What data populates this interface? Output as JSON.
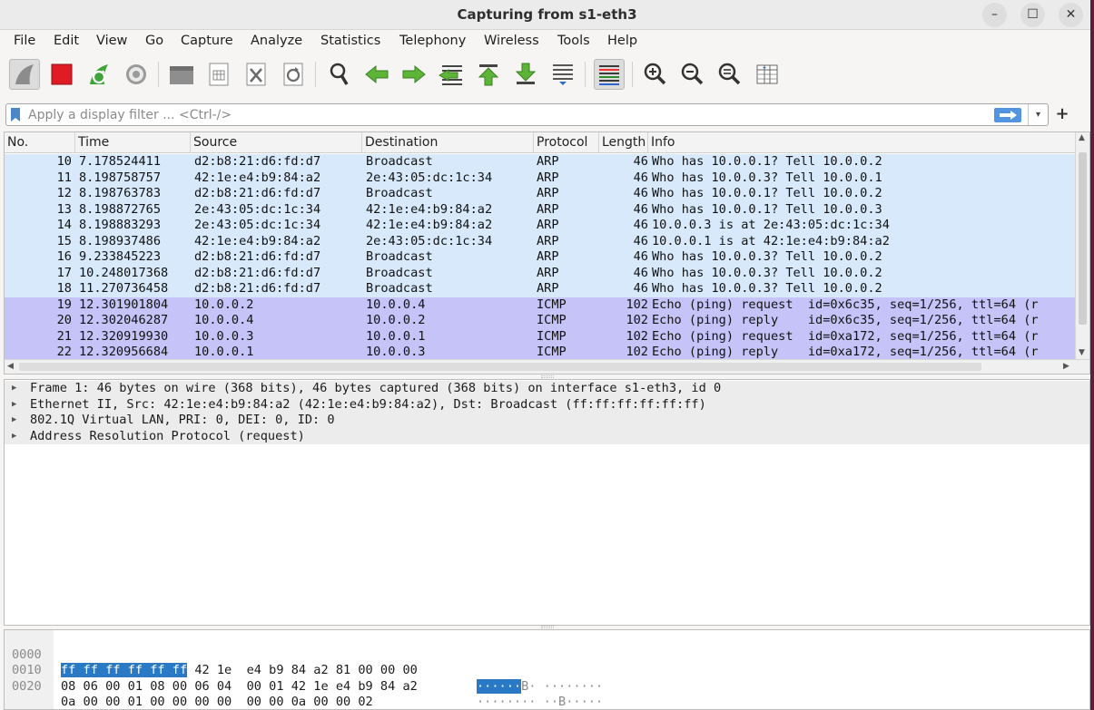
{
  "window": {
    "title": "Capturing from s1-eth3",
    "minimize": "–",
    "maximize": "☐",
    "close": "✕"
  },
  "menu": [
    "File",
    "Edit",
    "View",
    "Go",
    "Capture",
    "Analyze",
    "Statistics",
    "Telephony",
    "Wireless",
    "Tools",
    "Help"
  ],
  "toolbar": {
    "icons": [
      "shark-fin-start-icon",
      "stop-capture-icon",
      "restart-capture-icon",
      "capture-options-gear-icon",
      "open-file-icon",
      "save-file-icon",
      "close-file-icon",
      "reload-file-icon",
      "find-packet-icon",
      "go-back-icon",
      "go-forward-icon",
      "go-to-packet-icon",
      "go-first-icon",
      "go-last-icon",
      "auto-scroll-icon",
      "colorize-icon",
      "zoom-in-icon",
      "zoom-out-icon",
      "zoom-normal-icon",
      "resize-columns-icon"
    ]
  },
  "filter": {
    "placeholder": "Apply a display filter ... <Ctrl-/>",
    "value": "",
    "add_button": "+"
  },
  "packet_list": {
    "columns": [
      "No.",
      "Time",
      "Source",
      "Destination",
      "Protocol",
      "Length",
      "Info"
    ],
    "rows": [
      {
        "no": "10",
        "time": "7.178524411",
        "source": "d2:b8:21:d6:fd:d7",
        "destination": "Broadcast",
        "protocol": "ARP",
        "length": "46",
        "info": "Who has 10.0.0.1? Tell 10.0.0.2"
      },
      {
        "no": "11",
        "time": "8.198758757",
        "source": "42:1e:e4:b9:84:a2",
        "destination": "2e:43:05:dc:1c:34",
        "protocol": "ARP",
        "length": "46",
        "info": "Who has 10.0.0.3? Tell 10.0.0.1"
      },
      {
        "no": "12",
        "time": "8.198763783",
        "source": "d2:b8:21:d6:fd:d7",
        "destination": "Broadcast",
        "protocol": "ARP",
        "length": "46",
        "info": "Who has 10.0.0.1? Tell 10.0.0.2"
      },
      {
        "no": "13",
        "time": "8.198872765",
        "source": "2e:43:05:dc:1c:34",
        "destination": "42:1e:e4:b9:84:a2",
        "protocol": "ARP",
        "length": "46",
        "info": "Who has 10.0.0.1? Tell 10.0.0.3"
      },
      {
        "no": "14",
        "time": "8.198883293",
        "source": "2e:43:05:dc:1c:34",
        "destination": "42:1e:e4:b9:84:a2",
        "protocol": "ARP",
        "length": "46",
        "info": "10.0.0.3 is at 2e:43:05:dc:1c:34"
      },
      {
        "no": "15",
        "time": "8.198937486",
        "source": "42:1e:e4:b9:84:a2",
        "destination": "2e:43:05:dc:1c:34",
        "protocol": "ARP",
        "length": "46",
        "info": "10.0.0.1 is at 42:1e:e4:b9:84:a2"
      },
      {
        "no": "16",
        "time": "9.233845223",
        "source": "d2:b8:21:d6:fd:d7",
        "destination": "Broadcast",
        "protocol": "ARP",
        "length": "46",
        "info": "Who has 10.0.0.3? Tell 10.0.0.2"
      },
      {
        "no": "17",
        "time": "10.248017368",
        "source": "d2:b8:21:d6:fd:d7",
        "destination": "Broadcast",
        "protocol": "ARP",
        "length": "46",
        "info": "Who has 10.0.0.3? Tell 10.0.0.2"
      },
      {
        "no": "18",
        "time": "11.270736458",
        "source": "d2:b8:21:d6:fd:d7",
        "destination": "Broadcast",
        "protocol": "ARP",
        "length": "46",
        "info": "Who has 10.0.0.3? Tell 10.0.0.2"
      },
      {
        "no": "19",
        "time": "12.301901804",
        "source": "10.0.0.2",
        "destination": "10.0.0.4",
        "protocol": "ICMP",
        "length": "102",
        "info": "Echo (ping) request  id=0x6c35, seq=1/256, ttl=64 (r"
      },
      {
        "no": "20",
        "time": "12.302046287",
        "source": "10.0.0.4",
        "destination": "10.0.0.2",
        "protocol": "ICMP",
        "length": "102",
        "info": "Echo (ping) reply    id=0x6c35, seq=1/256, ttl=64 (r"
      },
      {
        "no": "21",
        "time": "12.320919930",
        "source": "10.0.0.3",
        "destination": "10.0.0.1",
        "protocol": "ICMP",
        "length": "102",
        "info": "Echo (ping) request  id=0xa172, seq=1/256, ttl=64 (r"
      },
      {
        "no": "22",
        "time": "12.320956684",
        "source": "10.0.0.1",
        "destination": "10.0.0.3",
        "protocol": "ICMP",
        "length": "102",
        "info": "Echo (ping) reply    id=0xa172, seq=1/256, ttl=64 (r"
      }
    ],
    "colors": {
      "ARP": "#d7e9fb",
      "ICMP": "#c5c3f7"
    }
  },
  "details": [
    "Frame 1: 46 bytes on wire (368 bits), 46 bytes captured (368 bits) on interface s1-eth3, id 0",
    "Ethernet II, Src: 42:1e:e4:b9:84:a2 (42:1e:e4:b9:84:a2), Dst: Broadcast (ff:ff:ff:ff:ff:ff)",
    "802.1Q Virtual LAN, PRI: 0, DEI: 0, ID: 0",
    "Address Resolution Protocol (request)"
  ],
  "hex": [
    {
      "offset": "0000",
      "hl_bytes": "ff ff ff ff ff ff",
      "bytes": " 42 1e  e4 b9 84 a2 81 00 00 00",
      "hl_ascii": "······",
      "ascii": "B· ········"
    },
    {
      "offset": "0010",
      "hl_bytes": "",
      "bytes": "08 06 00 01 08 00 06 04  00 01 42 1e e4 b9 84 a2",
      "hl_ascii": "",
      "ascii": "········ ··B·····"
    },
    {
      "offset": "0020",
      "hl_bytes": "",
      "bytes": "0a 00 00 01 00 00 00 00  00 00 0a 00 00 02",
      "hl_ascii": "",
      "ascii": "········ ······"
    }
  ]
}
